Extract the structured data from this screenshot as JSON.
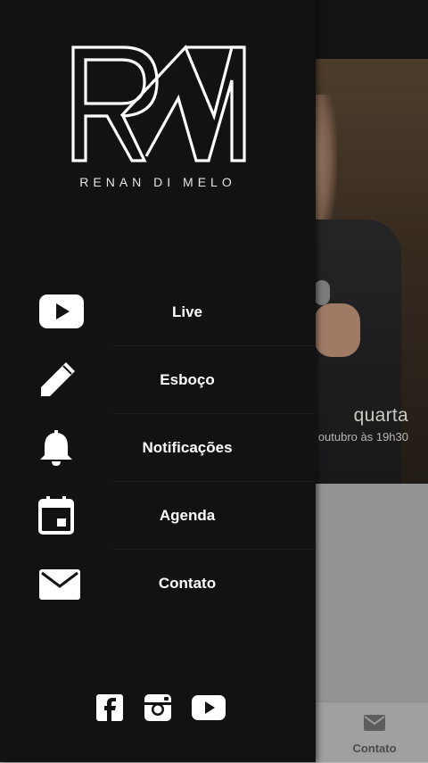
{
  "background": {
    "event_title": "quarta",
    "event_subtitle": "outubro às 19h30",
    "tabbar": {
      "active_tab_label": "Contato"
    }
  },
  "drawer": {
    "logo": {
      "monogram": "RM",
      "brand_name": "RENAN DI MELO"
    },
    "menu": [
      {
        "label": "Live",
        "icon": "youtube-play-icon"
      },
      {
        "label": "Esboço",
        "icon": "pencil-icon"
      },
      {
        "label": "Notificações",
        "icon": "bell-icon"
      },
      {
        "label": "Agenda",
        "icon": "calendar-icon"
      },
      {
        "label": "Contato",
        "icon": "envelope-icon"
      }
    ],
    "social": [
      "facebook-icon",
      "instagram-icon",
      "youtube-icon"
    ]
  },
  "colors": {
    "drawer_bg": "#121212",
    "text": "#ffffff"
  }
}
